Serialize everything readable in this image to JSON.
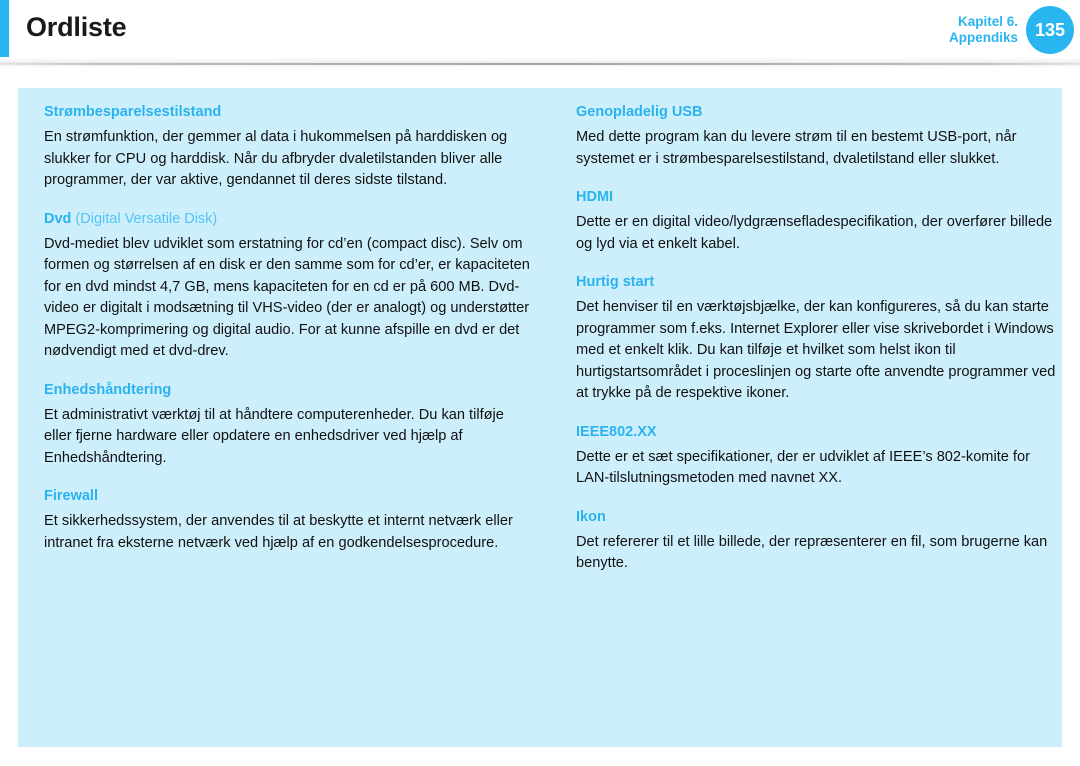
{
  "header": {
    "title": "Ordliste",
    "chapter_line1": "Kapitel 6.",
    "chapter_line2": "Appendiks",
    "page_number": "135",
    "accent_color": "#29b5ef",
    "title_color": "#1a1a1a"
  },
  "panel": {
    "background_color": "#cdeffc",
    "term_color": "#2ab3ee",
    "body_color": "#111111"
  },
  "columns": {
    "left": [
      {
        "term": "Strømbesparelsestilstand",
        "term_suffix": "",
        "definition": "En strømfunktion, der gemmer al data i hukommelsen på harddisken og slukker for CPU og harddisk. Når du afbryder dvaletilstanden bliver alle programmer, der var aktive, gendannet til deres sidste tilstand."
      },
      {
        "term": "Dvd",
        "term_suffix": " (Digital Versatile Disk)",
        "definition": "Dvd-mediet blev udviklet som erstatning for cd’en (compact disc). Selv om formen og størrelsen af en disk er den samme som for cd’er, er kapaciteten for en dvd mindst 4,7 GB, mens kapaciteten for en cd er på 600 MB. Dvd-video er digitalt i modsætning til VHS-video (der er analogt) og understøtter MPEG2-komprimering og digital audio. For at kunne afspille en dvd er det nødvendigt med et dvd-drev."
      },
      {
        "term": "Enhedshåndtering",
        "term_suffix": "",
        "definition": "Et administrativt værktøj til at håndtere computerenheder. Du kan tilføje eller fjerne hardware eller opdatere en enhedsdriver ved hjælp af Enhedshåndtering."
      },
      {
        "term": "Firewall",
        "term_suffix": "",
        "definition": "Et sikkerhedssystem, der anvendes til at beskytte et internt netværk eller intranet fra eksterne netværk ved hjælp af en godkendelsesprocedure."
      }
    ],
    "right": [
      {
        "term": "Genopladelig USB",
        "term_suffix": "",
        "definition": "Med dette program kan du levere strøm til en bestemt USB-port, når systemet er i strømbesparelsestilstand, dvaletilstand eller slukket."
      },
      {
        "term": "HDMI",
        "term_suffix": "",
        "definition": "Dette er en digital video/lydgrænsefladespecifikation, der overfører billede og lyd via et enkelt kabel."
      },
      {
        "term": "Hurtig start",
        "term_suffix": "",
        "definition": "Det henviser til en værktøjsbjælke, der kan konfigureres, så du kan starte programmer som f.eks. Internet Explorer eller vise skrivebordet i Windows med et enkelt klik. Du kan tilføje et hvilket som helst ikon til hurtigstartsområdet i proceslinjen og starte ofte anvendte programmer ved at trykke på de respektive ikoner."
      },
      {
        "term": "IEEE802.XX",
        "term_suffix": "",
        "definition": "Dette er et sæt specifikationer, der er udviklet af IEEE’s 802-komite for LAN-tilslutningsmetoden med navnet XX."
      },
      {
        "term": "Ikon",
        "term_suffix": "",
        "definition": "Det refererer til et lille billede, der repræsenterer en fil, som brugerne kan benytte."
      }
    ]
  }
}
